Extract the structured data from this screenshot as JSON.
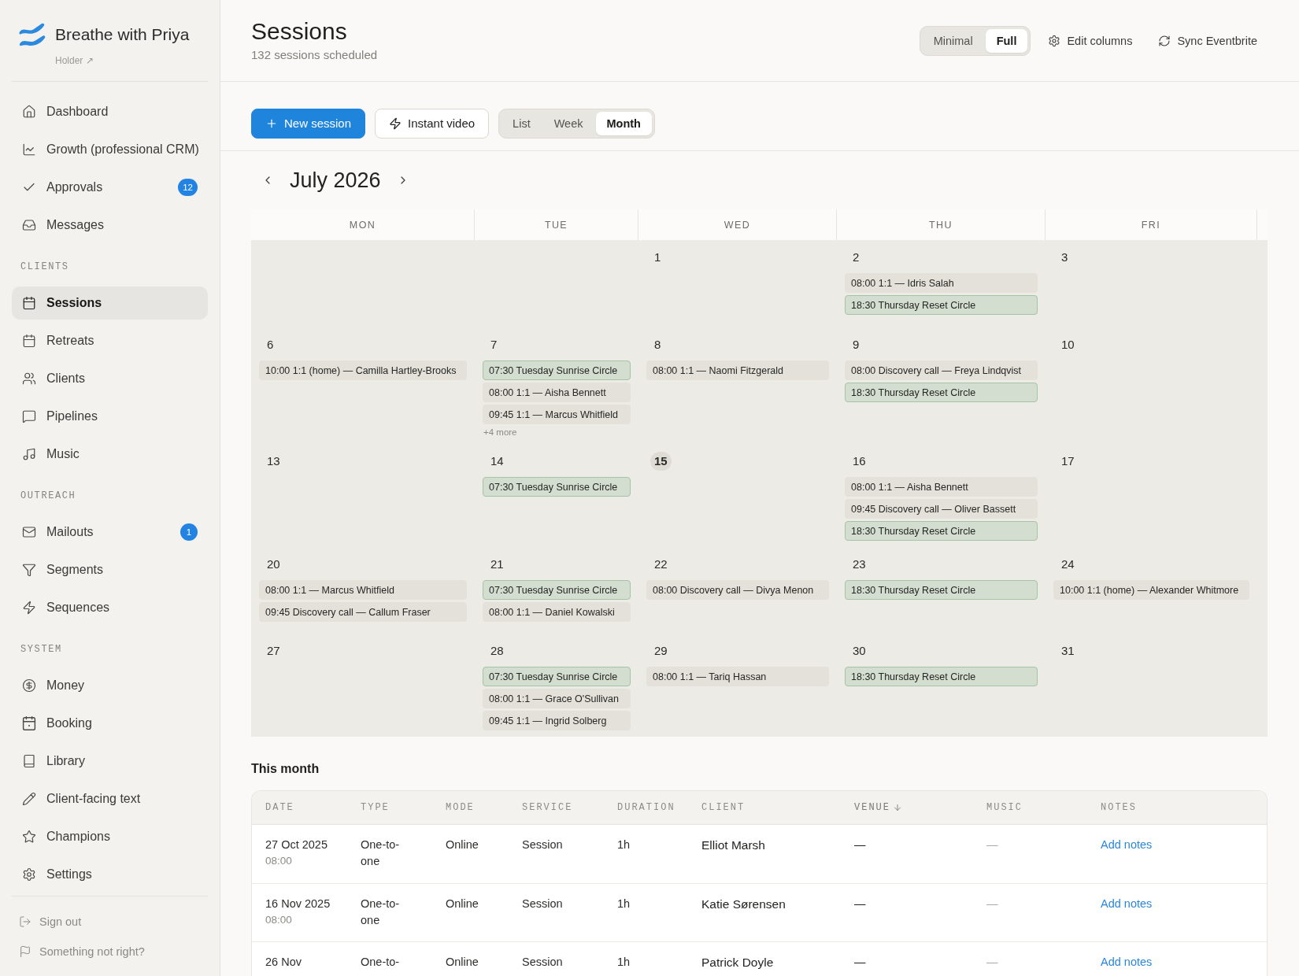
{
  "sidebar": {
    "brand": {
      "name": "Breathe with Priya",
      "role": "Holder ↗"
    },
    "sections": [
      {
        "items": [
          {
            "label": "Dashboard",
            "selected": false
          },
          {
            "label": "Growth (professional CRM)",
            "selected": false
          },
          {
            "label": "Approvals",
            "selected": false,
            "badge": "12"
          },
          {
            "label": "Messages",
            "selected": false
          }
        ]
      },
      {
        "title": "CLIENTS",
        "items": [
          {
            "label": "Sessions",
            "selected": true
          },
          {
            "label": "Retreats",
            "selected": false
          },
          {
            "label": "Clients",
            "selected": false
          },
          {
            "label": "Pipelines",
            "selected": false
          },
          {
            "label": "Music",
            "selected": false
          }
        ]
      },
      {
        "title": "OUTREACH",
        "items": [
          {
            "label": "Mailouts",
            "selected": false,
            "badge": "1"
          },
          {
            "label": "Segments",
            "selected": false
          },
          {
            "label": "Sequences",
            "selected": false
          }
        ]
      },
      {
        "title": "SYSTEM",
        "items": [
          {
            "label": "Money",
            "selected": false
          },
          {
            "label": "Booking",
            "selected": false
          },
          {
            "label": "Library",
            "selected": false
          },
          {
            "label": "Client-facing text",
            "selected": false
          },
          {
            "label": "Champions",
            "selected": false
          },
          {
            "label": "Settings",
            "selected": false
          }
        ]
      }
    ],
    "footer": [
      {
        "label": "Sign out"
      },
      {
        "label": "Something not right?"
      }
    ]
  },
  "header": {
    "title": "Sessions",
    "subtitle": "132 sessions scheduled",
    "density": [
      {
        "label": "Minimal",
        "selected": false
      },
      {
        "label": "Full",
        "selected": true
      }
    ],
    "actions": [
      {
        "label": "Edit columns"
      },
      {
        "label": "Sync Eventbrite"
      }
    ]
  },
  "toolbar": {
    "buttons": [
      {
        "label": "New session",
        "kind": "primary"
      },
      {
        "label": "Instant video",
        "kind": "secondary"
      }
    ],
    "views": [
      {
        "label": "List",
        "selected": false
      },
      {
        "label": "Week",
        "selected": false
      },
      {
        "label": "Month",
        "selected": true
      }
    ]
  },
  "calendar": {
    "month": "July 2026",
    "weekdays": [
      "MON",
      "TUE",
      "WED",
      "THU",
      "FRI"
    ],
    "weeks": [
      {
        "days": [
          {
            "kind": "blank"
          },
          {
            "kind": "blank"
          },
          {
            "kind": "day",
            "date": "1",
            "today": false
          },
          {
            "kind": "day",
            "date": "2",
            "today": false,
            "events": [
              {
                "label": "08:00 1:1 — Idris Salah",
                "kind": "individual"
              },
              {
                "label": "18:30 Thursday Reset Circle",
                "kind": "group"
              }
            ]
          },
          {
            "kind": "day",
            "date": "3",
            "today": false
          }
        ]
      },
      {
        "days": [
          {
            "kind": "day",
            "date": "6",
            "today": false,
            "events": [
              {
                "label": "10:00 1:1 (home) — Camilla Hartley-Brooks",
                "kind": "individual"
              }
            ]
          },
          {
            "kind": "day",
            "date": "7",
            "today": false,
            "events": [
              {
                "label": "07:30 Tuesday Sunrise Circle",
                "kind": "group"
              },
              {
                "label": "08:00 1:1 — Aisha Bennett",
                "kind": "individual"
              },
              {
                "label": "09:45 1:1 — Marcus Whitfield",
                "kind": "individual"
              }
            ],
            "more": "+4 more"
          },
          {
            "kind": "day",
            "date": "8",
            "today": false,
            "events": [
              {
                "label": "08:00 1:1 — Naomi Fitzgerald",
                "kind": "individual"
              }
            ]
          },
          {
            "kind": "day",
            "date": "9",
            "today": false,
            "events": [
              {
                "label": "08:00 Discovery call — Freya Lindqvist",
                "kind": "individual"
              },
              {
                "label": "18:30 Thursday Reset Circle",
                "kind": "group"
              }
            ]
          },
          {
            "kind": "day",
            "date": "10",
            "today": false
          }
        ]
      },
      {
        "days": [
          {
            "kind": "day",
            "date": "13",
            "today": false
          },
          {
            "kind": "day",
            "date": "14",
            "today": false,
            "events": [
              {
                "label": "07:30 Tuesday Sunrise Circle",
                "kind": "group"
              }
            ]
          },
          {
            "kind": "day",
            "date": "15",
            "today": true
          },
          {
            "kind": "day",
            "date": "16",
            "today": false,
            "events": [
              {
                "label": "08:00 1:1 — Aisha Bennett",
                "kind": "individual"
              },
              {
                "label": "09:45 Discovery call — Oliver Bassett",
                "kind": "individual"
              },
              {
                "label": "18:30 Thursday Reset Circle",
                "kind": "group"
              }
            ]
          },
          {
            "kind": "day",
            "date": "17",
            "today": false
          }
        ]
      },
      {
        "days": [
          {
            "kind": "day",
            "date": "20",
            "today": false,
            "events": [
              {
                "label": "08:00 1:1 — Marcus Whitfield",
                "kind": "individual"
              },
              {
                "label": "09:45 Discovery call — Callum Fraser",
                "kind": "individual"
              }
            ]
          },
          {
            "kind": "day",
            "date": "21",
            "today": false,
            "events": [
              {
                "label": "07:30 Tuesday Sunrise Circle",
                "kind": "group"
              },
              {
                "label": "08:00 1:1 — Daniel Kowalski",
                "kind": "individual"
              }
            ]
          },
          {
            "kind": "day",
            "date": "22",
            "today": false,
            "events": [
              {
                "label": "08:00 Discovery call — Divya Menon",
                "kind": "individual"
              }
            ]
          },
          {
            "kind": "day",
            "date": "23",
            "today": false,
            "events": [
              {
                "label": "18:30 Thursday Reset Circle",
                "kind": "group"
              }
            ]
          },
          {
            "kind": "day",
            "date": "24",
            "today": false,
            "events": [
              {
                "label": "10:00 1:1 (home) — Alexander Whitmore",
                "kind": "individual"
              }
            ]
          }
        ]
      },
      {
        "days": [
          {
            "kind": "day",
            "date": "27",
            "today": false
          },
          {
            "kind": "day",
            "date": "28",
            "today": false,
            "events": [
              {
                "label": "07:30 Tuesday Sunrise Circle",
                "kind": "group"
              },
              {
                "label": "08:00 1:1 — Grace O'Sullivan",
                "kind": "individual"
              },
              {
                "label": "09:45 1:1 — Ingrid Solberg",
                "kind": "individual"
              }
            ]
          },
          {
            "kind": "day",
            "date": "29",
            "today": false,
            "events": [
              {
                "label": "08:00 1:1 — Tariq Hassan",
                "kind": "individual"
              }
            ]
          },
          {
            "kind": "day",
            "date": "30",
            "today": false,
            "events": [
              {
                "label": "18:30 Thursday Reset Circle",
                "kind": "group"
              }
            ]
          },
          {
            "kind": "day",
            "date": "31",
            "today": false
          }
        ]
      }
    ]
  },
  "this_month": {
    "title": "This month",
    "columns": [
      {
        "label": "DATE",
        "sorted": false
      },
      {
        "label": "TYPE",
        "sorted": false
      },
      {
        "label": "MODE",
        "sorted": false
      },
      {
        "label": "SERVICE",
        "sorted": false
      },
      {
        "label": "DURATION",
        "sorted": false
      },
      {
        "label": "CLIENT",
        "sorted": false
      },
      {
        "label": "VENUE",
        "sorted": true
      },
      {
        "label": "MUSIC",
        "sorted": false
      },
      {
        "label": "NOTES",
        "sorted": false
      }
    ],
    "rows": [
      {
        "date": "27 Oct 2025",
        "time": "08:00",
        "type": "One-to-one",
        "mode": "Online",
        "service": "Session",
        "duration": "1h",
        "client": "Elliot Marsh",
        "venue": "—",
        "music": "—",
        "notes": "Add notes"
      },
      {
        "date": "16 Nov 2025",
        "time": "08:00",
        "type": "One-to-one",
        "mode": "Online",
        "service": "Session",
        "duration": "1h",
        "client": "Katie Sørensen",
        "venue": "—",
        "music": "—",
        "notes": "Add notes"
      },
      {
        "date": "26 Nov",
        "type": "One-to-",
        "mode": "Online",
        "service": "Session",
        "duration": "1h",
        "client": "Patrick Doyle",
        "venue": "—",
        "music": "—",
        "notes": "Add notes"
      }
    ]
  }
}
